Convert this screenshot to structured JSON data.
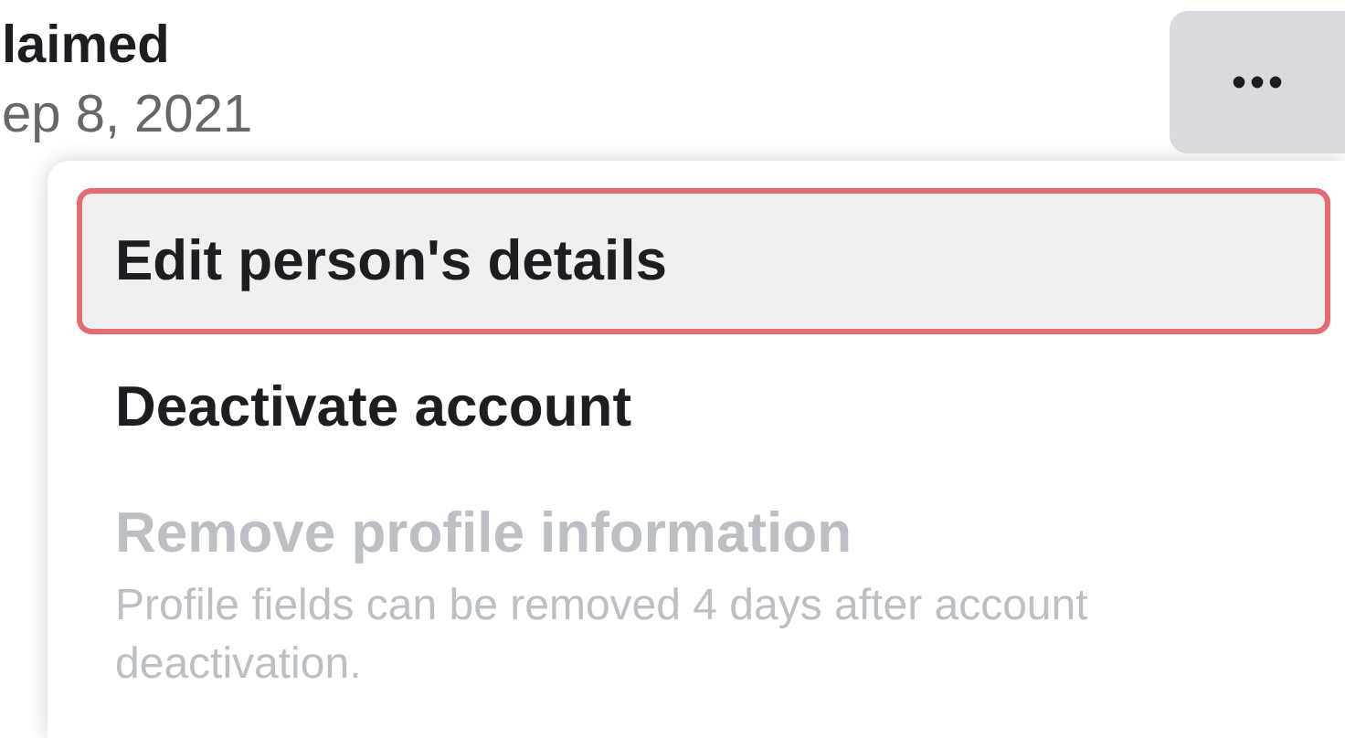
{
  "header": {
    "status": "laimed",
    "date": "ep 8, 2021"
  },
  "more_button": {
    "kind": "more"
  },
  "menu": {
    "items": [
      {
        "label": "Edit person's details",
        "selected": true,
        "disabled": false
      },
      {
        "label": "Deactivate account",
        "selected": false,
        "disabled": false
      },
      {
        "label": "Remove profile information",
        "selected": false,
        "disabled": true,
        "description": "Profile fields can be removed 4 days after account deactivation."
      }
    ]
  }
}
